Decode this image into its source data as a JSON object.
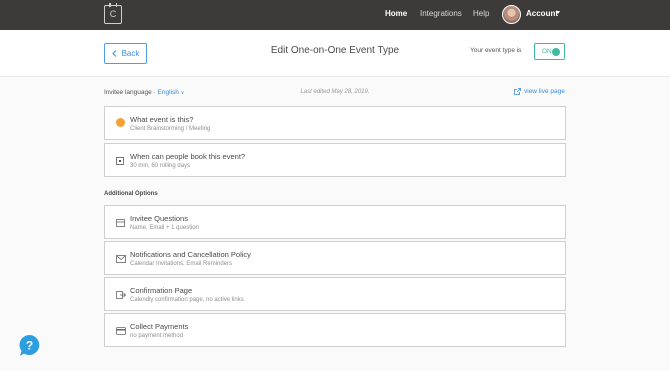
{
  "nav": {
    "logo_letter": "C",
    "home": "Home",
    "integrations": "Integrations",
    "help": "Help",
    "account": "Account"
  },
  "header": {
    "back_label": "Back",
    "title": "Edit One-on-One Event Type",
    "event_type_label": "Your event type is",
    "toggle_label": "ON"
  },
  "meta": {
    "language_label": "Invitee language",
    "language_value": "English",
    "last_edited": "Last edited May 28, 2019.",
    "view_live": "view live page"
  },
  "main_cards": [
    {
      "title": "What event is this?",
      "subtitle": "Client Brainstorming / Meeting",
      "icon": "orange-dot-icon"
    },
    {
      "title": "When can people book this event?",
      "subtitle": "30 min, 60 rolling days",
      "icon": "calendar-icon"
    }
  ],
  "additional": {
    "heading": "Additional Options",
    "cards": [
      {
        "title": "Invitee Questions",
        "subtitle": "Name, Email + 1 question",
        "icon": "form-icon"
      },
      {
        "title": "Notifications and Cancellation Policy",
        "subtitle": "Calendar Invitations, Email Reminders",
        "icon": "envelope-icon"
      },
      {
        "title": "Confirmation Page",
        "subtitle": "Calendly confirmation page, no active links",
        "icon": "redirect-icon"
      },
      {
        "title": "Collect Payments",
        "subtitle": "no payment method",
        "icon": "credit-card-icon"
      }
    ]
  },
  "help_widget": {
    "glyph": "?"
  },
  "colors": {
    "nav_bg": "#3d3a3a",
    "accent_blue": "#3c8ddd",
    "toggle_green": "#3fbb9e",
    "event_orange": "#f5a032",
    "help_blue": "#2d9ee0"
  }
}
